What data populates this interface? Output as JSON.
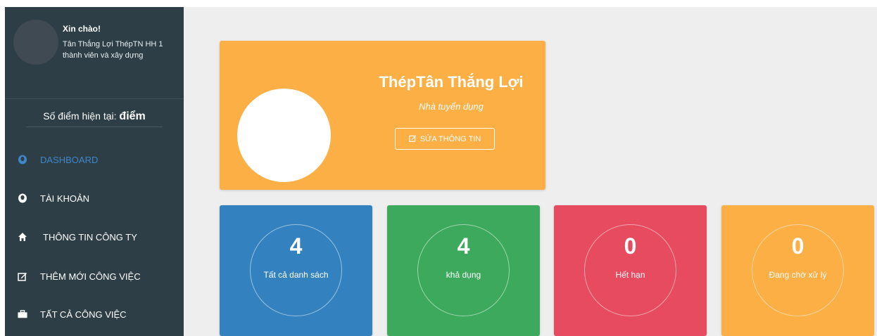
{
  "sidebar": {
    "greeting": "Xin chào!",
    "company_name": "Tân Thắng Lợi ThépTN HH 1 thành viên và xây dựng",
    "points_label": "Số điểm hiện tại:",
    "points_unit": "điểm",
    "menu": [
      {
        "label": "DASHBOARD",
        "icon": "user-icon",
        "active": true
      },
      {
        "label": "TÀI KHOẢN",
        "icon": "user-icon",
        "active": false
      },
      {
        "label": "THÔNG TIN CÔNG TY",
        "icon": "home-icon",
        "active": false
      },
      {
        "label": "THÊM MỚI CÔNG VIỆC",
        "icon": "edit-icon",
        "active": false
      },
      {
        "label": "TẤT CẢ CÔNG VIỆC",
        "icon": "briefcase-icon",
        "active": false
      }
    ]
  },
  "profile_card": {
    "title": "ThépTân Thắng Lợi",
    "role": "Nhà tuyển dụng",
    "edit_label": "SỬA THÔNG TIN",
    "color": "#fbaf44"
  },
  "stats": [
    {
      "value": "4",
      "label": "Tất cả danh sách",
      "color": "#3382bf"
    },
    {
      "value": "4",
      "label": "khả dụng",
      "color": "#3ca95c"
    },
    {
      "value": "0",
      "label": "Hết hạn",
      "color": "#e64b5f"
    },
    {
      "value": "0",
      "label": "Đang chờ xử lý",
      "color": "#fbaf44"
    }
  ],
  "colors": {
    "sidebar_bg": "#2d3e46",
    "active": "#3f87c9",
    "main_bg": "#eeeeee"
  }
}
